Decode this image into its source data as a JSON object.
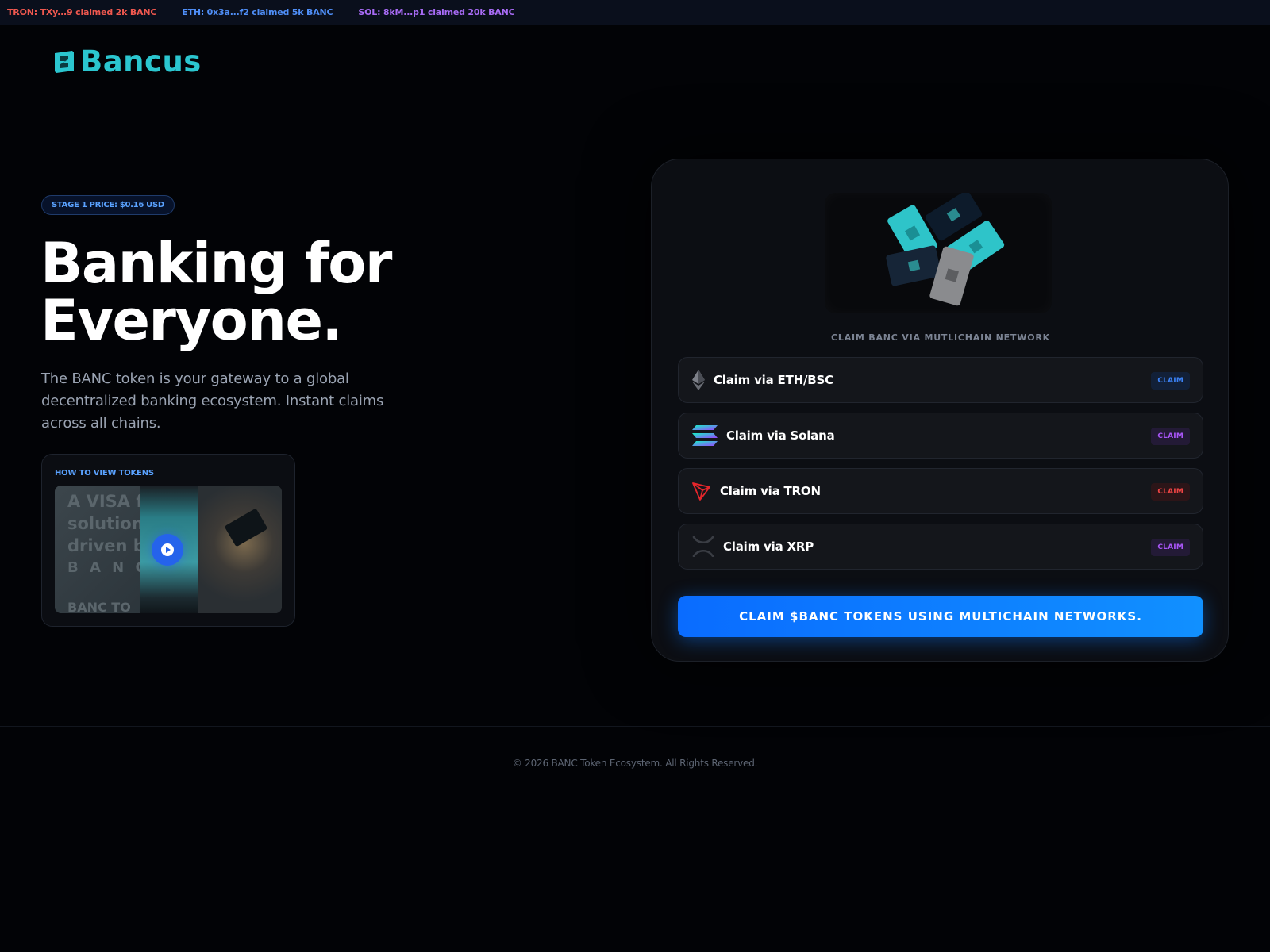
{
  "ticker": [
    {
      "text": "TRON: TXy...9 claimed 2k BANC",
      "color": "#f0584f"
    },
    {
      "text": "ETH: 0x3a...f2 claimed 5k BANC",
      "color": "#4f8ef7"
    },
    {
      "text": "SOL: 8kM...p1 claimed 20k BANC",
      "color": "#a86bf5"
    }
  ],
  "brand": {
    "name": "Bancus",
    "color": "#2bc6cf"
  },
  "hero": {
    "price_badge": "STAGE 1 PRICE: $0.16 USD",
    "title_line1": "Banking for",
    "title_line2": "Everyone.",
    "subtitle": "The BANC token is your gateway to a global decentralized banking ecosystem. Instant claims across all chains."
  },
  "video": {
    "label": "HOW TO VIEW TOKENS",
    "thumb_lines": [
      "A VISA fia",
      "solution",
      "driven by",
      "B A N C U",
      "BANC TO"
    ]
  },
  "claim_panel": {
    "caption": "CLAIM BANC VIA MUTLICHAIN NETWORK",
    "options": [
      {
        "label": "Claim via ETH/BSC",
        "badge": "CLAIM",
        "icon": "ethereum-icon",
        "badge_color": "#3b82f6"
      },
      {
        "label": "Claim via Solana",
        "badge": "CLAIM",
        "icon": "solana-icon",
        "badge_color": "#a855f7"
      },
      {
        "label": "Claim via TRON",
        "badge": "CLAIM",
        "icon": "tron-icon",
        "badge_color": "#ef4444"
      },
      {
        "label": "Claim via XRP",
        "badge": "CLAIM",
        "icon": "xrp-icon",
        "badge_color": "#a855f7"
      }
    ],
    "cta_label": "CLAIM $BANC TOKENS USING MULTICHAIN NETWORKS."
  },
  "footer": {
    "text": "© 2026 BANC Token Ecosystem. All Rights Reserved."
  }
}
